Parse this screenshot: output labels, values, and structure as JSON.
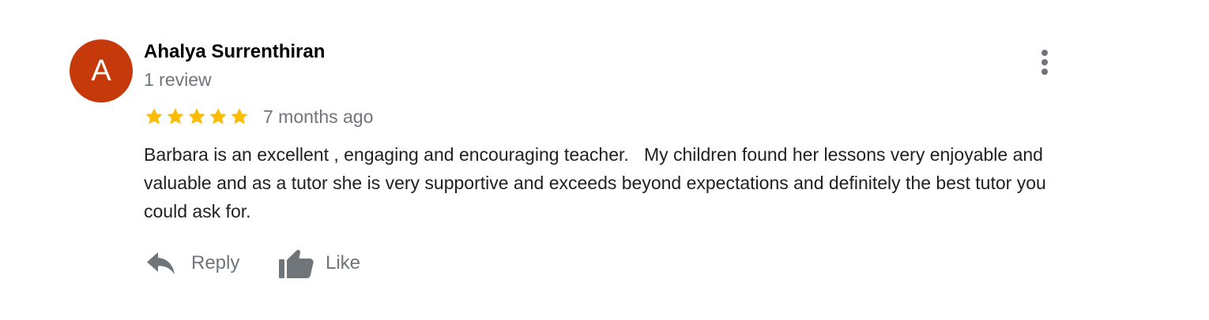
{
  "review": {
    "author": {
      "name": "Ahalya Surrenthiran",
      "avatar_initial": "A",
      "avatar_color": "#c5390b",
      "review_count": "1 review"
    },
    "rating": {
      "stars": 5,
      "max_stars": 5,
      "star_color": "#fbbc04"
    },
    "date": "7 months ago",
    "text": "Barbara is an excellent , engaging and encouraging teacher.   My children found her lessons very enjoyable and valuable and as a tutor she is very supportive and exceeds beyond expectations and definitely the best tutor you could ask for.",
    "more_options_icon": "more-vertical-icon",
    "actions": {
      "reply": {
        "label": "Reply",
        "icon": "reply-icon"
      },
      "like": {
        "label": "Like",
        "icon": "thumbs-up-icon"
      }
    }
  },
  "colors": {
    "secondary_text": "#70757a",
    "primary_text": "#202124"
  }
}
